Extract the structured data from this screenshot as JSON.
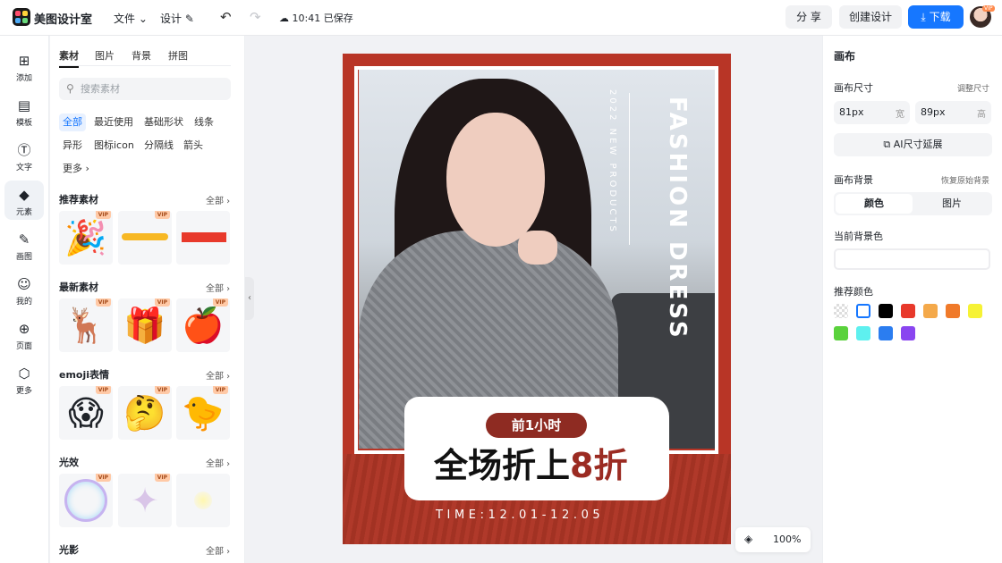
{
  "app": {
    "name": "美图设计室",
    "menu_file": "文件",
    "menu_design": "设计",
    "save_time": "10:41 已保存",
    "share_label": "分 享",
    "create_label": "创建设计",
    "download_label": "下载",
    "avatar_badge": "VIP"
  },
  "rail": {
    "items": [
      {
        "label": "添加",
        "icon": "plus-square-icon"
      },
      {
        "label": "模板",
        "icon": "template-icon"
      },
      {
        "label": "文字",
        "icon": "text-icon"
      },
      {
        "label": "元素",
        "icon": "shapes-icon"
      },
      {
        "label": "画图",
        "icon": "draw-icon"
      },
      {
        "label": "我的",
        "icon": "user-icon"
      },
      {
        "label": "页面",
        "icon": "page-add-icon"
      },
      {
        "label": "更多",
        "icon": "box-icon"
      }
    ],
    "active_index": 3
  },
  "panel": {
    "tabs": [
      "素材",
      "图片",
      "背景",
      "拼图"
    ],
    "search_placeholder": "搜索素材",
    "chips": [
      "全部",
      "最近使用",
      "基础形状",
      "线条",
      "异形",
      "图标icon",
      "分隔线",
      "箭头",
      "更多"
    ],
    "more_label": "全部",
    "sections": [
      {
        "title": "推荐素材",
        "items": [
          {
            "name": "party-popper",
            "vip": "VIP"
          },
          {
            "name": "yellow-brush-stroke",
            "vip": "VIP"
          },
          {
            "name": "red-rectangle",
            "vip": ""
          }
        ]
      },
      {
        "title": "最新素材",
        "items": [
          {
            "name": "reindeer-sleigh",
            "vip": "VIP"
          },
          {
            "name": "snow-globe-gift",
            "vip": "VIP"
          },
          {
            "name": "red-apple",
            "vip": "VIP"
          }
        ]
      },
      {
        "title": "emoji表情",
        "items": [
          {
            "name": "shocked-emoji",
            "vip": "VIP"
          },
          {
            "name": "thinking-emoji",
            "vip": "VIP"
          },
          {
            "name": "chick-emoji",
            "vip": "VIP"
          }
        ]
      },
      {
        "title": "光效",
        "items": [
          {
            "name": "bubble-ring",
            "vip": "VIP"
          },
          {
            "name": "sparkle-star",
            "vip": "VIP"
          },
          {
            "name": "glow-dot",
            "vip": ""
          }
        ]
      },
      {
        "title": "光影",
        "items": []
      }
    ]
  },
  "poster": {
    "fashion_title": "FASHION DRESS",
    "products_line": "2022 NEW PRODUCTS",
    "pill_text": "前1小时",
    "sale_main": "全场折上",
    "sale_accent": "8折",
    "time_text": "TIME:12.01-12.05",
    "colors": {
      "frame": "#b83526",
      "accent": "#8e2b22"
    }
  },
  "zoom": {
    "value": "100%"
  },
  "right_panel": {
    "title": "画布",
    "size_label": "画布尺寸",
    "adjust_label": "调整尺寸",
    "width_value": "81px",
    "width_unit": "宽",
    "height_value": "89px",
    "height_unit": "高",
    "ai_extend_label": "AI尺寸延展",
    "bg_label": "画布背景",
    "restore_label": "恢复原始背景",
    "seg_color": "颜色",
    "seg_image": "图片",
    "current_bg_label": "当前背景色",
    "recommend_label": "推荐颜色",
    "swatches": [
      "transparent",
      "#ffffff",
      "#000000",
      "#e8392b",
      "#f4a94a",
      "#f07a2a",
      "#f6f235",
      "#5ad23c",
      "#5ef0ef",
      "#2b7df0",
      "#8a46f0"
    ]
  }
}
